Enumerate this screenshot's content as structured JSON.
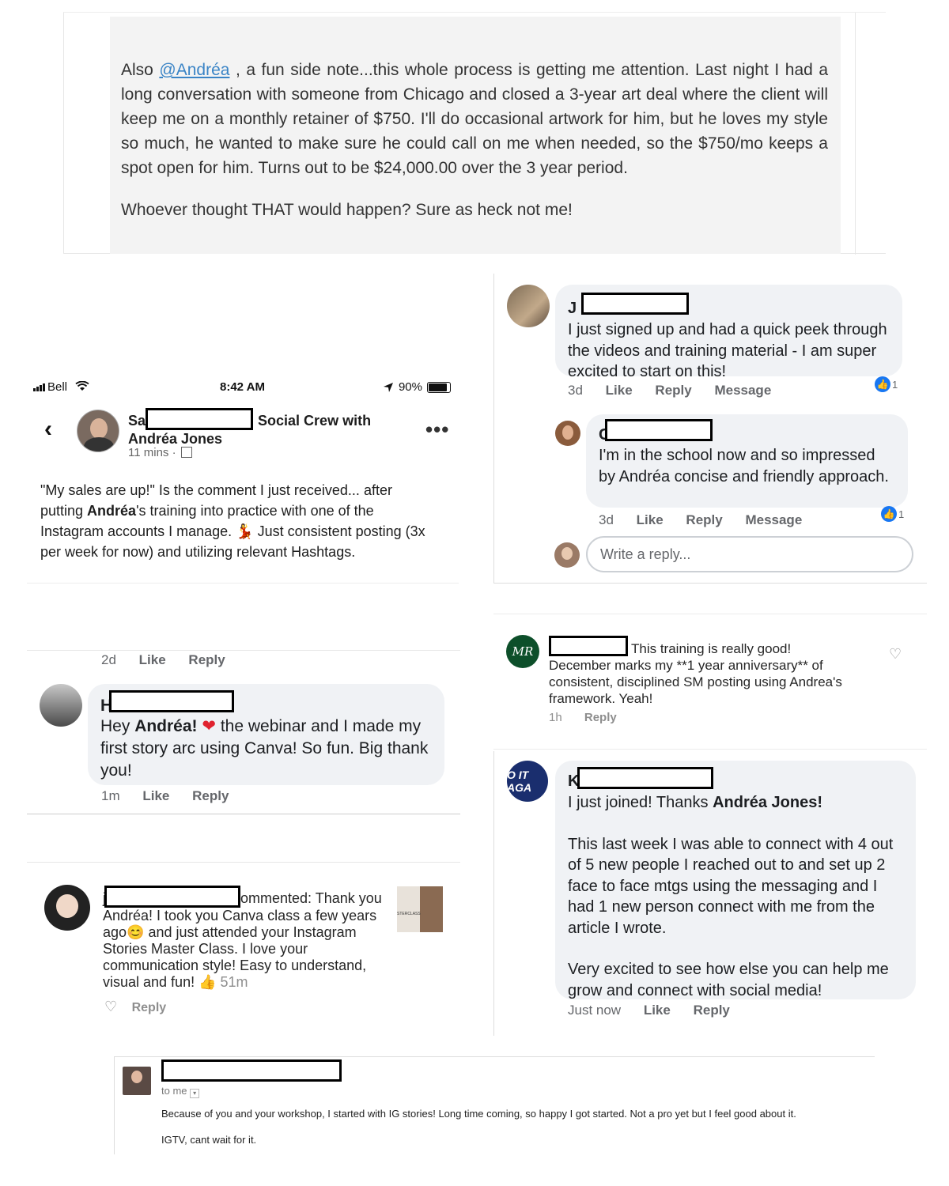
{
  "forum": {
    "p1_prefix": "Also",
    "mention": "@Andréa",
    "p1_rest": ", a fun side note...this whole process is getting me attention. Last night I had a long conversation with someone from Chicago and closed a 3-year art deal where the client will keep me on a monthly retainer of $750. I'll do occasional artwork for him, but he loves my style so much, he wanted to make sure he could call on me when needed, so the $750/mo keeps a spot open for him. Turns out to be $24,000.00 over the 3 year period.",
    "p2": "Whoever thought THAT would happen? Sure as heck not me!"
  },
  "mobile_post": {
    "carrier": "Bell",
    "time": "8:42 AM",
    "battery": "90%",
    "author_prefix": "Sa",
    "author_suffix": "Social Crew with",
    "author_line2": "Andréa Jones",
    "posted": "11 mins ·",
    "text_1": "\"My sales are up!\" Is the comment I just received... after putting ",
    "text_bold": "Andréa",
    "text_2": "'s training into practice with one of the Instagram accounts I manage. ",
    "text_emoji": "💃",
    "text_3": " Just consistent posting (3x per week for now) and utilizing relevant Hashtags."
  },
  "fb_thread": {
    "c1_initial": "J",
    "c1_text": "I just signed up and had a quick peek through the videos and training material - I am super excited to start on this!",
    "c1_time": "3d",
    "c1_reactions": "1",
    "c2_initial": "C",
    "c2_text": "I'm in the school now and so impressed by Andréa concise and friendly approach.",
    "c2_time": "3d",
    "c2_reactions": "1",
    "like": "Like",
    "reply": "Reply",
    "message": "Message",
    "reply_placeholder": "Write a reply..."
  },
  "fb_comment2": {
    "prev_time": "2d",
    "initial": "H",
    "text_1": "Hey ",
    "text_bold": "Andréa!",
    "text_2": " the webinar and I made my first story arc using Canva! So fun. Big thank you!",
    "time": "1m",
    "like": "Like",
    "reply": "Reply"
  },
  "ig_comment1": {
    "avatar_text": "MR",
    "text_1": "This training is really good!",
    "text_2": "December marks my **1 year anniversary** of consistent, disciplined SM posting using Andrea's framework.  Yeah!",
    "time": "1h",
    "reply": "Reply"
  },
  "ig_comment2": {
    "initial": "j",
    "text": "ommented: Thank you Andréa!  I took you Canva class a few years ago😊 and just attended your Instagram Stories Master Class.  I love your communication style!  Easy to understand, visual and fun! 👍",
    "time": "51m",
    "reply": "Reply",
    "thumb_label": "STERCLASS"
  },
  "fb_comment3": {
    "avatar_text": "O IT AGA",
    "initial": "K",
    "line1_prefix": "I just joined! Thanks ",
    "line1_bold": "Andréa Jones!",
    "p2": "This last week I was able to connect with 4 out of 5 new people I reached out to and set up 2 face to face mtgs using the messaging and I had 1 new person connect with me from the article I wrote.",
    "p3": "Very excited to see how else you can help me grow and connect with social media!",
    "time": "Just now",
    "like": "Like",
    "reply": "Reply"
  },
  "email": {
    "to": "to me",
    "line1": "Because of you and your workshop, I started with IG stories! Long time coming, so happy I got started. Not a pro yet but I feel good about it.",
    "line2": "IGTV, cant wait for it."
  },
  "colors": {
    "fb_blue": "#1877f2",
    "bubble_gray": "#f0f2f5",
    "mention_blue": "#3a84c6",
    "heart_red": "#e0232f"
  }
}
